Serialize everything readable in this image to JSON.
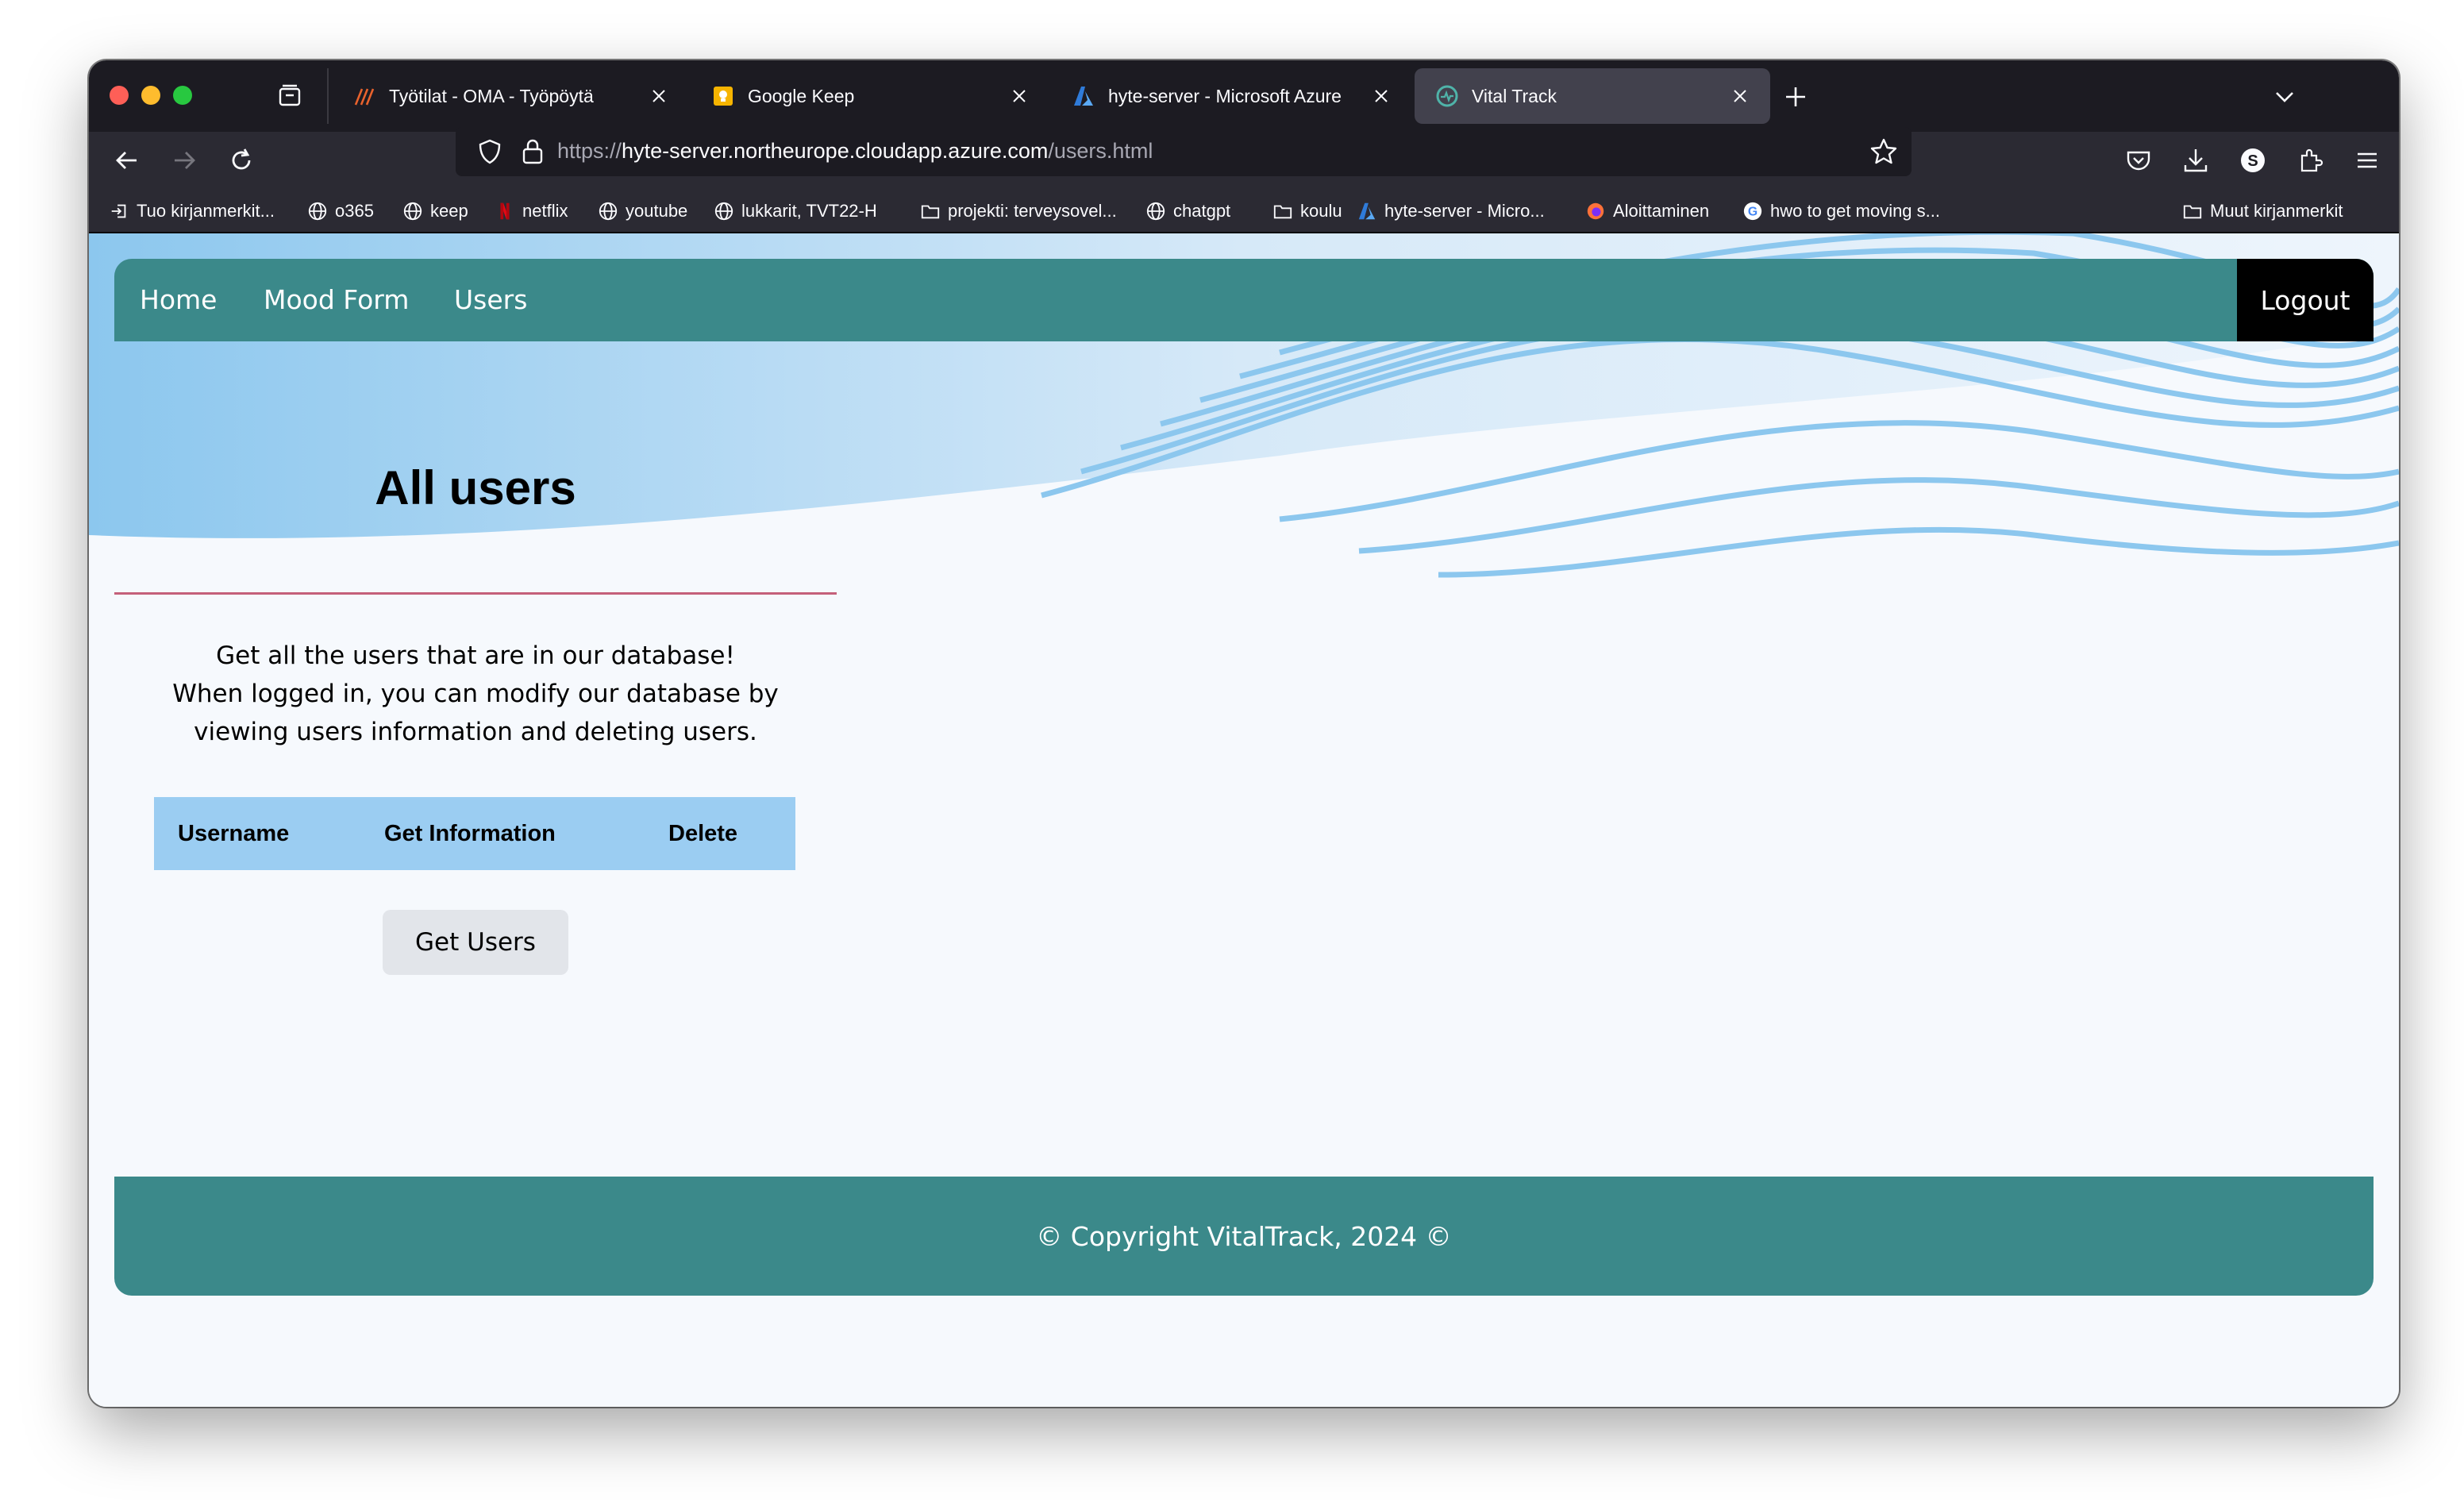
{
  "browser": {
    "tabs": [
      {
        "title": "Työtilat - OMA - Työpöytä",
        "icon": "oma-favicon",
        "active": false
      },
      {
        "title": "Google Keep",
        "icon": "keep-favicon",
        "active": false
      },
      {
        "title": "hyte-server - Microsoft Azure",
        "icon": "azure-favicon",
        "active": false
      },
      {
        "title": "Vital Track",
        "icon": "vitaltrack-favicon",
        "active": true
      }
    ],
    "url": {
      "scheme": "https://",
      "host": "hyte-server.northeurope.cloudapp.azure.com",
      "path": "/users.html"
    },
    "bookmarks": [
      {
        "label": "Tuo kirjanmerkit...",
        "icon": "import-icon"
      },
      {
        "label": "o365",
        "icon": "globe-icon"
      },
      {
        "label": "keep",
        "icon": "globe-icon"
      },
      {
        "label": "netflix",
        "icon": "netflix-icon"
      },
      {
        "label": "youtube",
        "icon": "globe-icon"
      },
      {
        "label": "lukkarit, TVT22-H",
        "icon": "globe-icon"
      },
      {
        "label": "projekti: terveysovel...",
        "icon": "folder-icon"
      },
      {
        "label": "chatgpt",
        "icon": "globe-icon"
      },
      {
        "label": "koulu",
        "icon": "folder-icon"
      },
      {
        "label": "hyte-server - Micro...",
        "icon": "azure-icon"
      },
      {
        "label": "Aloittaminen",
        "icon": "firefox-icon"
      },
      {
        "label": "hwo to get moving s...",
        "icon": "google-icon"
      },
      {
        "label": "Muut kirjanmerkit",
        "icon": "folder-icon"
      }
    ]
  },
  "site": {
    "nav": {
      "home": "Home",
      "mood_form": "Mood Form",
      "users": "Users",
      "logout": "Logout"
    },
    "title": "All users",
    "intro": [
      "Get all the users that are in our database!",
      "When logged in, you can modify our database by",
      "viewing users information and deleting users."
    ],
    "table": {
      "headers": [
        "Username",
        "Get Information",
        "Delete"
      ]
    },
    "get_users_button": "Get Users",
    "footer": "© Copyright VitalTrack, 2024 ©"
  },
  "colors": {
    "teal": "#3b898a",
    "table_header": "#9bcdf2",
    "wave": "#8cc7ee",
    "heading_underline": "#c4607a"
  }
}
